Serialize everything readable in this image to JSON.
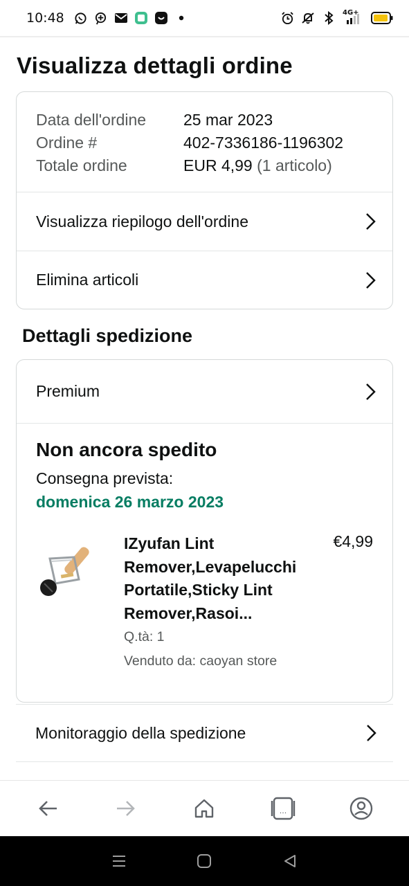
{
  "status_bar": {
    "time": "10:48",
    "left_icons": [
      "whatsapp-icon",
      "signal-plus-icon",
      "mail-icon",
      "app-square-icon",
      "app-dark-icon",
      "dot-icon"
    ],
    "right_icons": [
      "alarm-icon",
      "mute-icon",
      "bluetooth-icon",
      "network-4g-icon",
      "battery-icon"
    ],
    "network_label": "4G+"
  },
  "page": {
    "title": "Visualizza dettagli ordine"
  },
  "order_summary": {
    "date_label": "Data dell'ordine",
    "date_value": "25 mar 2023",
    "order_label": "Ordine #",
    "order_value": "402-7336186-1196302",
    "total_label": "Totale ordine",
    "total_value": "EUR 4,99",
    "total_items": "(1 articolo)"
  },
  "order_actions": {
    "summary_link": "Visualizza riepilogo dell'ordine",
    "delete_link": "Elimina articoli"
  },
  "shipping": {
    "section_title": "Dettagli spedizione",
    "service": "Premium",
    "status": "Non ancora spedito",
    "delivery_label": "Consegna prevista:",
    "delivery_date": "domenica 26 marzo 2023",
    "item": {
      "title": "IZyufan Lint Remover,Levapelucchi Portatile,Sticky Lint Remover,Rasoi...",
      "price": "€4,99",
      "qty": "Q.tà: 1",
      "seller": "Venduto da: caoyan store"
    },
    "tracking_link": "Monitoraggio della spedizione"
  },
  "browser_bar": {
    "buttons": [
      "back-arrow-icon",
      "forward-arrow-icon",
      "home-icon",
      "tabs-icon",
      "account-icon"
    ],
    "tabs_indicator": "..."
  },
  "android_nav": {
    "buttons": [
      "recent-apps-icon",
      "home-circle-icon",
      "back-triangle-icon"
    ]
  },
  "colors": {
    "delivery_green": "#067d62",
    "text_primary": "#0f1111",
    "text_secondary": "#565959",
    "border": "#d5d9d9"
  }
}
